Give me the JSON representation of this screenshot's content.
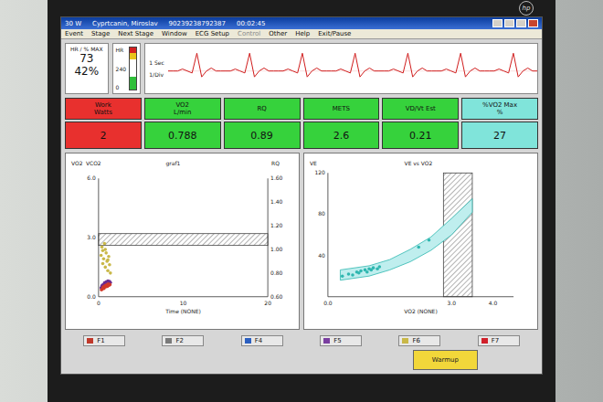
{
  "bezel": {
    "logo": "hp"
  },
  "window": {
    "title_fields": [
      "30 W",
      "Cyprtcanin, Miroslav",
      "90239238792387",
      "00:02:45"
    ]
  },
  "menu": [
    {
      "label": "Event",
      "disabled": false
    },
    {
      "label": "Stage",
      "disabled": false
    },
    {
      "label": "Next Stage",
      "disabled": false
    },
    {
      "label": "Window",
      "disabled": false
    },
    {
      "label": "ECG Setup",
      "disabled": false
    },
    {
      "label": "Control",
      "disabled": true
    },
    {
      "label": "Other",
      "disabled": false
    },
    {
      "label": "Help",
      "disabled": false
    },
    {
      "label": "Exit/Pause",
      "disabled": false
    }
  ],
  "hr_box": {
    "label": "HR / % MAX",
    "value": "73",
    "percent": "42%"
  },
  "hr_meter": {
    "label": "HR",
    "top": "240",
    "bottom": "0",
    "level": 0.3
  },
  "ecg": {
    "labels": [
      "1 Sec",
      "1/Div"
    ],
    "values": [
      0,
      0,
      0,
      0.1,
      0,
      -0.1,
      0.9,
      -0.3,
      0,
      0.15,
      0,
      0,
      0,
      0,
      0.1,
      0,
      -0.1,
      0.9,
      -0.3,
      0,
      0.15,
      0,
      0,
      0,
      0,
      0.1,
      0,
      -0.1,
      0.9,
      -0.3,
      0,
      0.15,
      0,
      0,
      0,
      0,
      0.1,
      0,
      -0.1,
      0.9,
      -0.3,
      0,
      0.15,
      0,
      0,
      0,
      0,
      0.1,
      0,
      -0.1,
      0.9,
      -0.3,
      0,
      0.15,
      0,
      0,
      0,
      0,
      0.1,
      0,
      -0.1,
      0.9,
      -0.3,
      0,
      0.15,
      0,
      0,
      0,
      0,
      0.1,
      0,
      -0.1,
      0.9,
      -0.3,
      0,
      0.15,
      0,
      0
    ]
  },
  "tiles": [
    {
      "label": "Work",
      "unit": "Watts",
      "value": "2",
      "color": "#e8302e"
    },
    {
      "label": "VO2",
      "unit": "L/min",
      "value": "0.788",
      "color": "#36d23c"
    },
    {
      "label": "RQ",
      "value": "0.89",
      "color": "#36d23c"
    },
    {
      "label": "METS",
      "value": "2.6",
      "color": "#36d23c"
    },
    {
      "label": "VD/Vt Est",
      "value": "0.21",
      "color": "#36d23c"
    },
    {
      "label": "%VO2 Max",
      "unit": "%",
      "value": "27",
      "color": "#80e4da"
    }
  ],
  "left_chart": {
    "title": "graf1",
    "left_labels": [
      "VO2",
      "VCO2"
    ],
    "right_label": "RQ",
    "left_ticks": [
      {
        "label": "0.0",
        "value": 0
      },
      {
        "label": "3.0",
        "value": 3
      },
      {
        "label": "6.0",
        "value": 6
      }
    ],
    "right_ticks": [
      {
        "label": "0.60",
        "value": 0.6
      },
      {
        "label": "0.80",
        "value": 0.8
      },
      {
        "label": "1.00",
        "value": 1.0
      },
      {
        "label": "1.20",
        "value": 1.2
      },
      {
        "label": "1.40",
        "value": 1.4
      },
      {
        "label": "1.60",
        "value": 1.6
      }
    ],
    "x_ticks": [
      {
        "label": "0",
        "value": 0
      },
      {
        "label": "10",
        "value": 10
      },
      {
        "label": "20",
        "value": 20
      }
    ],
    "x_title": "Time (NONE)",
    "band": {
      "low": 2.6,
      "high": 3.2
    },
    "series": [
      {
        "axis": "right",
        "color": "#c9b848",
        "times": [
          0.3,
          0.4,
          0.5,
          0.6,
          0.7,
          0.8,
          0.9,
          1.0,
          1.1,
          1.2,
          1.3,
          1.4,
          0.5,
          0.8,
          1.1
        ],
        "values": [
          0.95,
          1.02,
          0.88,
          0.92,
          1.05,
          0.85,
          0.97,
          0.9,
          0.82,
          0.94,
          0.87,
          0.8,
          0.99,
          1.0,
          0.91
        ]
      },
      {
        "axis": "left",
        "color": "#6a2c91",
        "times": [
          0.3,
          0.4,
          0.5,
          0.6,
          0.7,
          0.8,
          0.9,
          1.0,
          1.1,
          1.2,
          1.3,
          1.4
        ],
        "values": [
          0.45,
          0.55,
          0.6,
          0.5,
          0.7,
          0.65,
          0.75,
          0.6,
          0.8,
          0.7,
          0.78,
          0.72
        ]
      },
      {
        "axis": "left",
        "color": "#d23a2a",
        "times": [
          0.35,
          0.45,
          0.55,
          0.65,
          0.75,
          0.85,
          0.95,
          1.05,
          1.15,
          1.25,
          1.35
        ],
        "values": [
          0.35,
          0.4,
          0.5,
          0.42,
          0.55,
          0.5,
          0.6,
          0.52,
          0.65,
          0.58,
          0.62
        ]
      }
    ]
  },
  "right_chart": {
    "title": "VE vs VO2",
    "y_label": "VE",
    "y_ticks": [
      {
        "label": "40",
        "value": 40
      },
      {
        "label": "80",
        "value": 80
      },
      {
        "label": "120",
        "value": 120
      }
    ],
    "x_ticks": [
      {
        "label": "0.0",
        "value": 0
      },
      {
        "label": "3.0",
        "value": 3
      },
      {
        "label": "4.0",
        "value": 4
      }
    ],
    "x_max": 4.5,
    "x_title": "VO2 (NONE)",
    "band": {
      "low": 2.8,
      "high": 3.5
    },
    "predicted": {
      "vo2": [
        0.3,
        1.0,
        1.5,
        2.0,
        2.5,
        3.0,
        3.5
      ],
      "low": [
        16,
        20,
        26,
        34,
        45,
        60,
        82
      ],
      "high": [
        26,
        30,
        36,
        46,
        58,
        76,
        95
      ]
    },
    "points": {
      "color": "#2fb7b0",
      "vo2": [
        0.35,
        0.5,
        0.6,
        0.7,
        0.75,
        0.8,
        0.9,
        0.95,
        1.0,
        1.05,
        1.1,
        1.2,
        1.25,
        2.2,
        2.45
      ],
      "ve": [
        20,
        22,
        21,
        24,
        23,
        25,
        26,
        24,
        27,
        26,
        28,
        27,
        29,
        48,
        55
      ]
    }
  },
  "fkeys": [
    {
      "label": "F1",
      "color": "#c0392b"
    },
    {
      "label": "F2",
      "color": "#7a7a7a"
    },
    {
      "label": "F4",
      "color": "#2b5fc0"
    },
    {
      "label": "F5",
      "color": "#7a3fa0"
    },
    {
      "label": "F6",
      "color": "#c9b848"
    },
    {
      "label": "F7",
      "color": "#d0202a"
    }
  ],
  "warmup": {
    "label": "Warmup"
  }
}
